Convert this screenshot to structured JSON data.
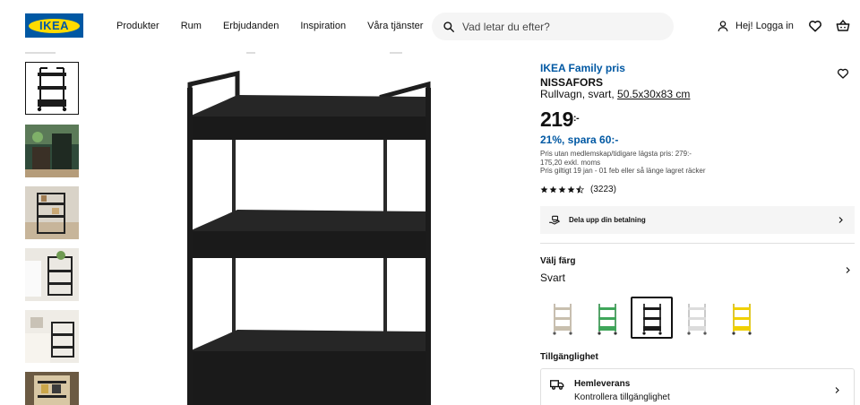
{
  "header": {
    "logo_text": "IKEA",
    "nav": [
      "Produkter",
      "Rum",
      "Erbjudanden",
      "Inspiration",
      "Våra tjänster"
    ],
    "search_placeholder": "Vad letar du efter?",
    "login_label": "Hej! Logga in"
  },
  "gallery": {
    "thumbnail_count": 6,
    "active_index": 0
  },
  "product": {
    "badge": "IKEA Family pris",
    "name": "NISSAFORS",
    "description": "Rullvagn, svart, ",
    "dimensions": "50.5x30x83 cm",
    "price": "219",
    "price_suffix": ":-",
    "saving": "21%, spara 60:-",
    "fine_print": [
      "Pris utan medlemskap/tidigare lägsta pris: 279:-",
      "175,20 exkl. moms",
      "Pris giltigt 19 jan - 01 feb eller så länge lagret räcker"
    ],
    "rating": 4.5,
    "review_count": "(3223)",
    "payment_label": "Dela upp din betalning"
  },
  "colors": {
    "label": "Välj färg",
    "selected_name": "Svart",
    "options": [
      {
        "name": "beige",
        "hex": "#c8bfae",
        "selected": false
      },
      {
        "name": "green",
        "hex": "#3fa65a",
        "selected": false
      },
      {
        "name": "black",
        "hex": "#1b1b1b",
        "selected": true
      },
      {
        "name": "white",
        "hex": "#e8e8e8",
        "selected": false
      },
      {
        "name": "yellow",
        "hex": "#f0d000",
        "selected": false
      }
    ]
  },
  "availability": {
    "label": "Tillgänglighet",
    "delivery_title": "Hemleverans",
    "delivery_sub": "Kontrollera tillgänglighet"
  },
  "theme": {
    "brand_blue": "#0058a3",
    "brand_yellow": "#ffdb00"
  }
}
